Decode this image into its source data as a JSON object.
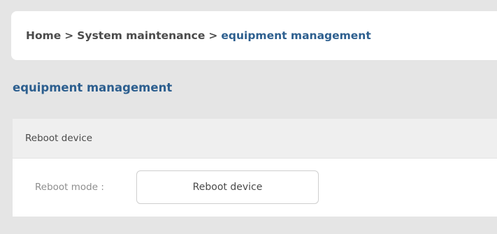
{
  "breadcrumb": {
    "items": [
      "Home",
      "System maintenance",
      "equipment management"
    ],
    "separator": ">"
  },
  "page": {
    "title": "equipment management"
  },
  "panel": {
    "header": "Reboot device",
    "field_label": "Reboot mode :",
    "button_label": "Reboot device"
  },
  "colors": {
    "accent": "#2d5f8f",
    "background": "#e5e5e5",
    "panel_header_bg": "#efefef"
  }
}
